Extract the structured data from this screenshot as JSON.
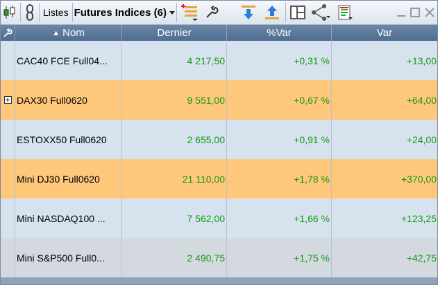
{
  "toolbar": {
    "listes_label": "Listes",
    "list_name": "Futures Indices (6)"
  },
  "columns": [
    "Nom",
    "Dernier",
    "%Var",
    "Var"
  ],
  "sort_indicator": "▲",
  "rows": [
    {
      "name": "CAC40 FCE Full04...",
      "last": "4 217,50",
      "pct": "+0,31 %",
      "var": "+13,00",
      "bg": "blue",
      "expand": false
    },
    {
      "name": "DAX30 Full0620",
      "last": "9 551,00",
      "pct": "+0,67 %",
      "var": "+64,00",
      "bg": "orange",
      "expand": true
    },
    {
      "name": "ESTOXX50 Full0620",
      "last": "2 655,00",
      "pct": "+0,91 %",
      "var": "+24,00",
      "bg": "blue",
      "expand": false
    },
    {
      "name": "Mini DJ30 Full0620",
      "last": "21 110,00",
      "pct": "+1,78 %",
      "var": "+370,00",
      "bg": "orange",
      "expand": false
    },
    {
      "name": "Mini NASDAQ100 ...",
      "last": "7 562,00",
      "pct": "+1,66 %",
      "var": "+123,25",
      "bg": "blue",
      "expand": false
    },
    {
      "name": "Mini S&P500 Full0...",
      "last": "2 490,75",
      "pct": "+1,75 %",
      "var": "+42,75",
      "bg": "grey",
      "expand": false
    }
  ],
  "colors": {
    "positive": "#139a13",
    "row_orange": "#fec77a",
    "row_blue": "#d6e3ee",
    "header": "#5a7899"
  }
}
